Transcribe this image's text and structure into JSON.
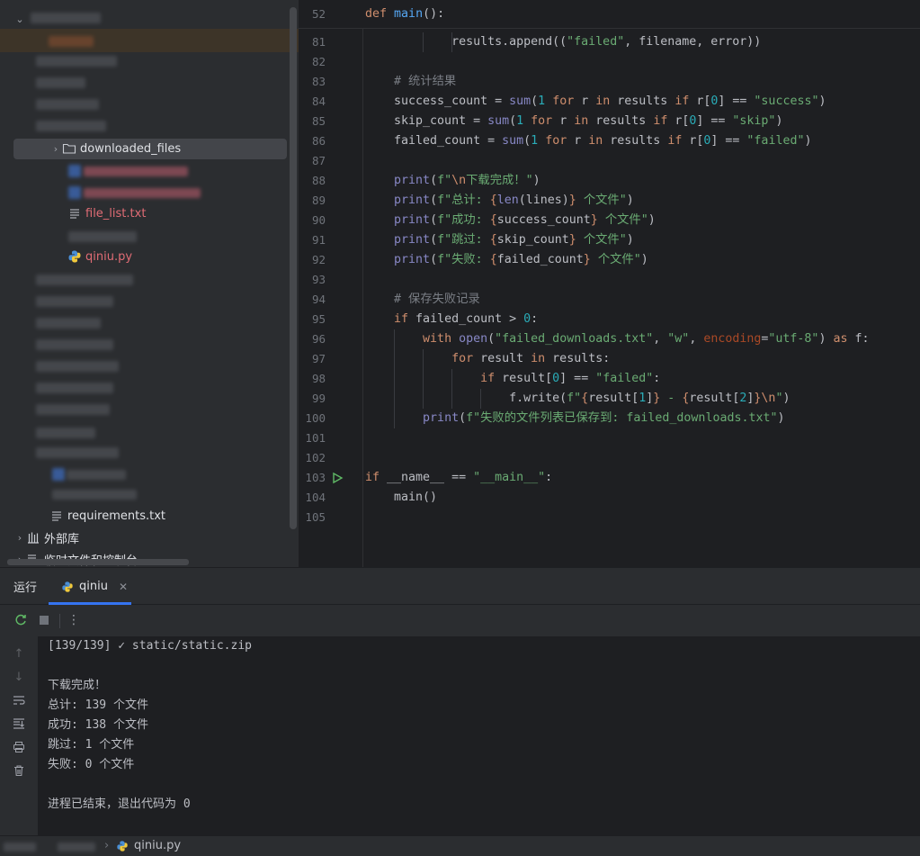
{
  "project_tree": {
    "downloaded_folder": "downloaded_files",
    "file_list": "file_list.txt",
    "qiniu": "qiniu.py",
    "requirements": "requirements.txt",
    "external_libs": "外部库",
    "scratches": "临时文件和控制台"
  },
  "editor": {
    "sticky": {
      "num": "52",
      "code_def": "def",
      "code_fn": "main",
      "code_rest": "():"
    },
    "lines": {
      "81": "81",
      "82": "82",
      "83": "83",
      "84": "84",
      "85": "85",
      "86": "86",
      "87": "87",
      "88": "88",
      "89": "89",
      "90": "90",
      "91": "91",
      "92": "92",
      "93": "93",
      "94": "94",
      "95": "95",
      "96": "96",
      "97": "97",
      "98": "98",
      "99": "99",
      "100": "100",
      "101": "101",
      "102": "102",
      "103": "103",
      "104": "104",
      "105": "105"
    },
    "comment_stats": "# 统计结果",
    "comment_save": "# 保存失败记录",
    "s_failed": "\"failed\"",
    "s_success": "\"success\"",
    "s_skip": "\"skip\"",
    "print_done_a": "f\"",
    "print_done_esc": "\\n",
    "print_done_b": "下载完成！\"",
    "p_total_a": "f\"总计: ",
    "p_total_b": "个文件\"",
    "p_success_a": "f\"成功: ",
    "p_skip_a": "f\"跳过: ",
    "p_fail_a": "f\"失败: ",
    "s_filename": "\"failed_downloads.txt\"",
    "s_w": "\"w\"",
    "s_utf8": "\"utf-8\"",
    "p_saved": "f\"失败的文件列表已保存到: failed_downloads.txt\"",
    "s_main": "\"__main__\""
  },
  "run_panel": {
    "tab_run": "运行",
    "tab_config": "qiniu",
    "console": [
      "[139/139] ✓ static/static.zip",
      "",
      "下载完成！",
      "总计: 139 个文件",
      "成功: 138 个文件",
      "跳过: 1 个文件",
      "失败: 0 个文件",
      "",
      "进程已结束，退出代码为 0"
    ]
  },
  "statusbar": {
    "file": "qiniu.py"
  }
}
